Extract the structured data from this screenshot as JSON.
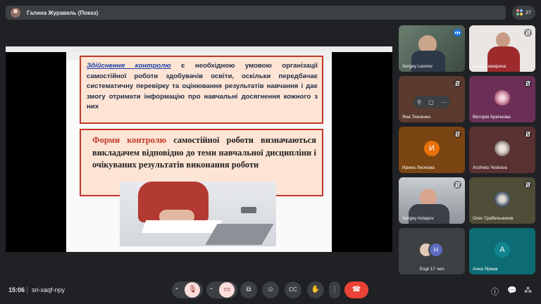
{
  "topbar": {
    "presenter_name": "Галина Журавель (Показ)",
    "participants_count": "27"
  },
  "slide": {
    "box1_highlight": "Здійснення контролю",
    "box1_text": " є необхідною умовою організації самостійної роботи здобувачів освіти, оскільки передбачає систематичну перевірку та оцінювання результатів навчання і дає змогу отримати інформацію про навчальні досягнення кожного з них",
    "box2_highlight": "Форми контролю",
    "box2_text": " самостійної роботи визначаються викладачем відповідно до теми навчальної дисципліни і очікуваних результатів виконання роботи"
  },
  "participants": [
    {
      "name": "Sergey Leonov",
      "kind": "video",
      "speaking": true
    },
    {
      "name": "Анна Самарина",
      "kind": "video",
      "muted": true
    },
    {
      "name": "Яна Ткаченко",
      "kind": "blank",
      "muted": true
    },
    {
      "name": "Вікторія Крючкова",
      "kind": "image",
      "muted": true
    },
    {
      "name": "Ирина Леонова",
      "kind": "letter",
      "letter": "И",
      "muted": true
    },
    {
      "name": "Anzhela Yeskova",
      "kind": "image",
      "muted": true
    },
    {
      "name": "Sergey Astapov",
      "kind": "video",
      "muted": true
    },
    {
      "name": "Олег Грабельников",
      "kind": "image",
      "muted": true
    },
    {
      "name": "Ещё 17 чел.",
      "kind": "more",
      "letter": "Н"
    },
    {
      "name": "Анна Ярмак",
      "kind": "letter",
      "letter": "А"
    }
  ],
  "bottom": {
    "time": "15:06",
    "meeting_code": "sri-xaqf-npy"
  },
  "colors": {
    "background": "#202124",
    "end_call": "#ea4335",
    "muted_control": "#f9dedc",
    "slide_accent": "#c0392b"
  }
}
